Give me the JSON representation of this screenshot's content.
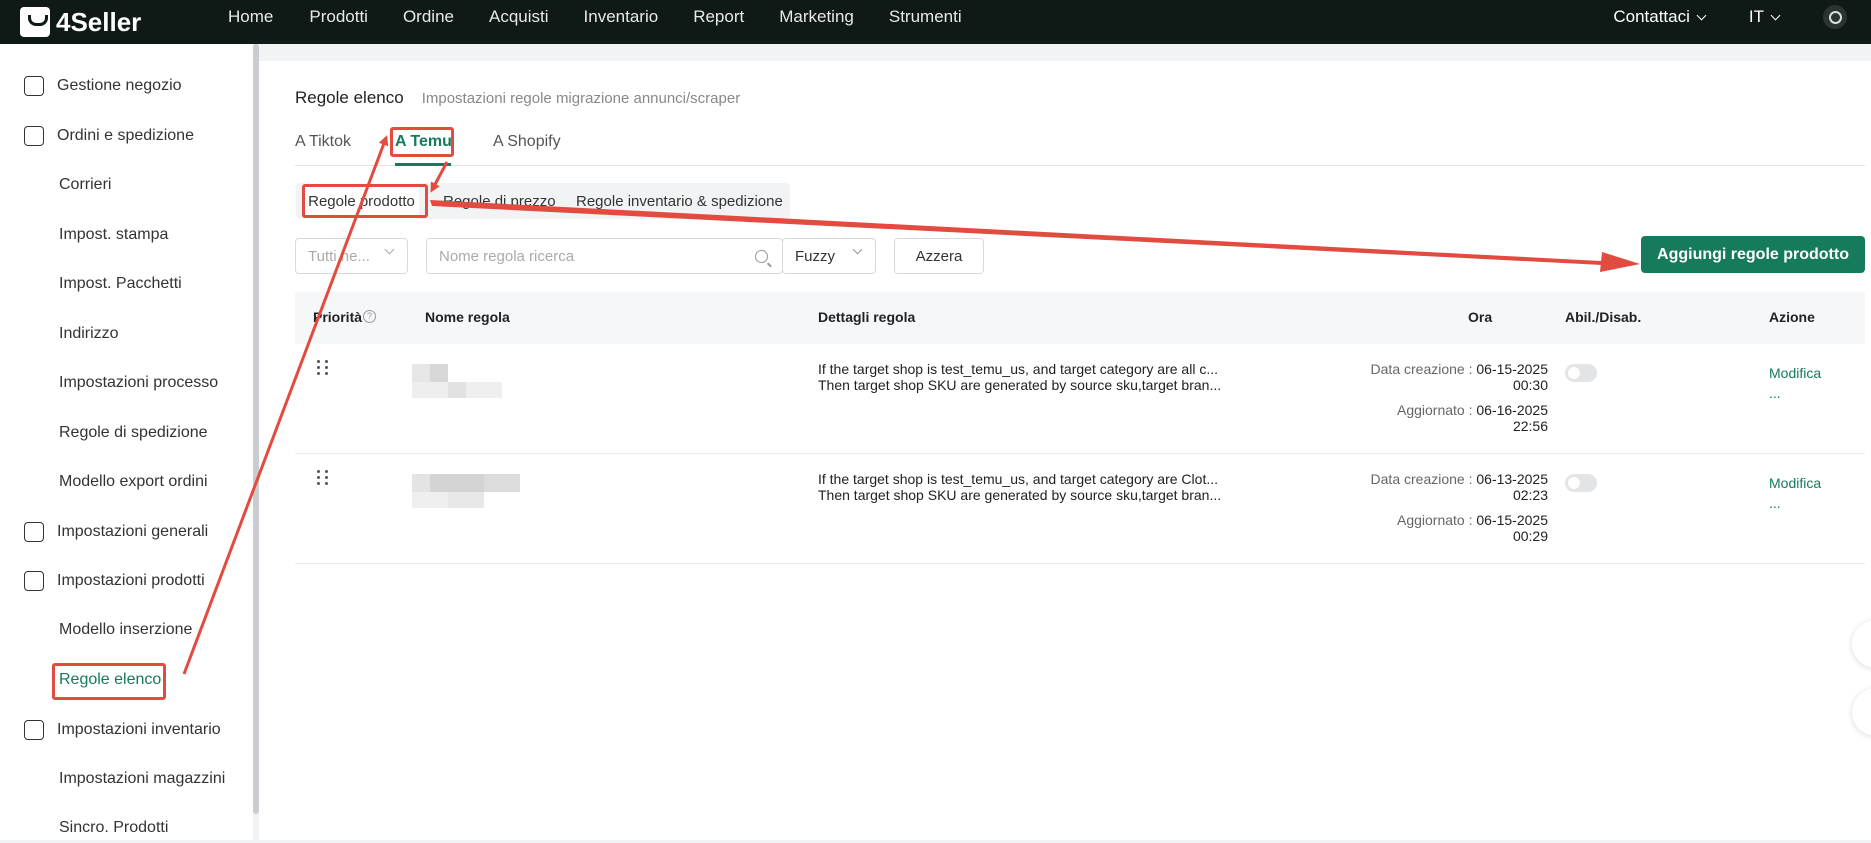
{
  "app": {
    "brand": "4Seller"
  },
  "nav": {
    "items": [
      "Home",
      "Prodotti",
      "Ordine",
      "Acquisti",
      "Inventario",
      "Report",
      "Marketing",
      "Strumenti"
    ]
  },
  "topright": {
    "contact": "Contattaci",
    "lang": "IT"
  },
  "sidebar": {
    "items": [
      {
        "label": "Gestione negozio",
        "level": "parent",
        "icon": "store-icon"
      },
      {
        "label": "Ordini e spedizione",
        "level": "parent",
        "icon": "clipboard-icon"
      },
      {
        "label": "Corrieri",
        "level": "child"
      },
      {
        "label": "Impost. stampa",
        "level": "child"
      },
      {
        "label": "Impost. Pacchetti",
        "level": "child"
      },
      {
        "label": "Indirizzo",
        "level": "child"
      },
      {
        "label": "Impostazioni processo",
        "level": "child"
      },
      {
        "label": "Regole di spedizione",
        "level": "child"
      },
      {
        "label": "Modello export ordini",
        "level": "child"
      },
      {
        "label": "Impostazioni generali",
        "level": "parent",
        "icon": "printer-icon"
      },
      {
        "label": "Impostazioni prodotti",
        "level": "parent",
        "icon": "upload-box-icon"
      },
      {
        "label": "Modello inserzione",
        "level": "child"
      },
      {
        "label": "Regole elenco",
        "level": "child",
        "active": true
      },
      {
        "label": "Impostazioni inventario",
        "level": "parent",
        "icon": "house-icon"
      },
      {
        "label": "Impostazioni magazzini",
        "level": "child"
      },
      {
        "label": "Sincro. Prodotti",
        "level": "child"
      }
    ]
  },
  "page": {
    "title": "Regole elenco",
    "subtitle": "Impostazioni regole migrazione annunci/scraper",
    "tabs": [
      "A Tiktok",
      "A Temu",
      "A Shopify"
    ],
    "segments": [
      "Regole prodotto",
      "Regole di prezzo",
      "Regole inventario & spedizione"
    ]
  },
  "filters": {
    "status_placeholder": "Tutti ne...",
    "search_placeholder": "Nome regola ricerca",
    "match_mode": "Fuzzy",
    "reset_label": "Azzera",
    "add_label": "Aggiungi regole prodotto"
  },
  "table": {
    "headers": {
      "priority": "Priorità",
      "name": "Nome regola",
      "details": "Dettagli regola",
      "time": "Ora",
      "toggle": "Abil./Disab.",
      "action": "Azione"
    },
    "rows": [
      {
        "detail1": "If the target shop is test_temu_us, and target category are all c...",
        "detail2": "Then target shop SKU are generated by source sku,target bran...",
        "created_label": "Data creazione :",
        "created_date": "06-15-2025",
        "created_time": "00:30",
        "updated_label": "Aggiornato :",
        "updated_date": "06-16-2025",
        "updated_time": "22:56",
        "enabled": false,
        "edit": "Modifica",
        "more": "..."
      },
      {
        "detail1": "If the target shop is test_temu_us, and target category are Clot...",
        "detail2": "Then target shop SKU are generated by source sku,target bran...",
        "created_label": "Data creazione :",
        "created_date": "06-13-2025",
        "created_time": "02:23",
        "updated_label": "Aggiornato :",
        "updated_date": "06-15-2025",
        "updated_time": "00:29",
        "enabled": false,
        "edit": "Modifica",
        "more": "..."
      }
    ]
  },
  "colors": {
    "accent": "#167a5d",
    "topbar": "#0f1a17",
    "annotation": "#e24b3f"
  }
}
